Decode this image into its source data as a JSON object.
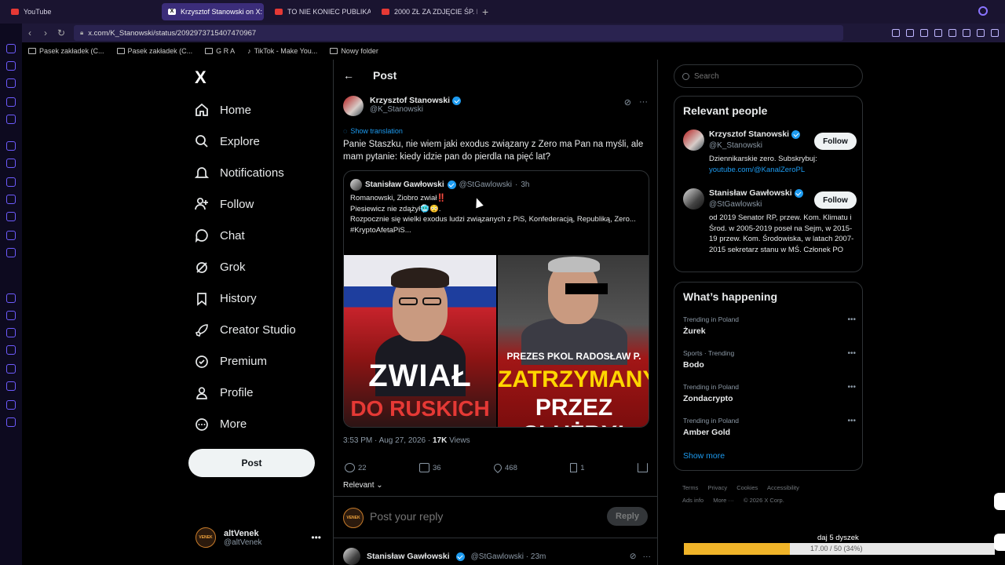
{
  "browser": {
    "tabs": [
      {
        "label": "YouTube",
        "icon": "youtube-icon",
        "active": false
      },
      {
        "label": "Krzysztof Stanowski on X:",
        "icon": "x-logo-icon",
        "active": true
      },
      {
        "label": "TO NIE KONIEC PUBLIKACJ",
        "icon": "youtube-icon",
        "active": false
      },
      {
        "label": "2000 ZŁ ZA ZDJĘCIE ŚP. L",
        "icon": "youtube-icon",
        "active": false
      }
    ],
    "url": "x.com/K_Stanowski/status/2092973715407470967",
    "bookmarks": [
      "Pasek zakładek (C...",
      "Pasek zakładek (C...",
      "G R A",
      "TikTok - Make You...",
      "Nowy folder"
    ]
  },
  "nav": {
    "logo": "X",
    "items": [
      {
        "label": "Home",
        "icon": "home-icon"
      },
      {
        "label": "Explore",
        "icon": "search-icon"
      },
      {
        "label": "Notifications",
        "icon": "bell-icon"
      },
      {
        "label": "Follow",
        "icon": "add-person-icon"
      },
      {
        "label": "Chat",
        "icon": "chat-bubble-icon"
      },
      {
        "label": "Grok",
        "icon": "grok-icon"
      },
      {
        "label": "History",
        "icon": "bookmark-icon"
      },
      {
        "label": "Creator Studio",
        "icon": "rocket-icon"
      },
      {
        "label": "Premium",
        "icon": "verified-icon"
      },
      {
        "label": "Profile",
        "icon": "person-icon"
      },
      {
        "label": "More",
        "icon": "more-circle-icon"
      }
    ],
    "post_label": "Post",
    "account": {
      "name": "altVenek",
      "handle": "@altVenek",
      "avatar_text": "VENEK"
    }
  },
  "post": {
    "header": "Post",
    "author": {
      "name": "Krzysztof Stanowski",
      "handle": "@K_Stanowski"
    },
    "translate_label": "Show translation",
    "text": "Panie Staszku, nie wiem jaki exodus związany z Zero ma Pan na myśli, ale mam pytanie: kiedy idzie pan do pierdla na pięć lat?",
    "quote": {
      "name": "Stanisław Gawłowski",
      "handle": "@StGawlowski",
      "time": "3h",
      "lines": [
        "Romanowski, Ziobro zwiał‼️",
        "Piesiewicz nie zdążył🥶😳.",
        "Rozpocznie się wielki exodus ludzi związanych z PiS, Konfederacją, Republiką, Zero...",
        "#KryptoAfetaPiS..."
      ],
      "image1": {
        "line1": "ZWIAŁ",
        "line2": "DO RUSKICH"
      },
      "image2": {
        "line1": "PREZES PKOL RADOSŁAW P.",
        "line2": "ZATRZYMANY",
        "line3": "PRZEZ SŁUŻBY!"
      }
    },
    "time": "3:53 PM · Aug 27, 2026 ·",
    "views_count": "17K",
    "views_label": "Views",
    "stats": {
      "replies": "22",
      "reposts": "36",
      "likes": "468",
      "bookmarks": "1"
    },
    "sort_label": "Relevant",
    "reply_placeholder": "Post your reply",
    "reply_button": "Reply",
    "next_reply": {
      "name": "Stanisław Gawłowski",
      "handle": "@StGawlowski · 23m"
    }
  },
  "right": {
    "search_placeholder": "Search",
    "relevant_title": "Relevant people",
    "people": [
      {
        "name": "Krzysztof Stanowski",
        "handle": "@K_Stanowski",
        "bio": "Dziennikarskie zero. Subskrybuj:",
        "link": "youtube.com/@KanalZeroPL",
        "follow": "Follow"
      },
      {
        "name": "Stanisław Gawłowski",
        "handle": "@StGawlowski",
        "bio": "od 2019 Senator RP, przew. Kom. Klimatu i Środ. w 2005-2019 poseł na Sejm, w 2015-19 przew. Kom. Środowiska, w latach 2007-2015 sekretarz stanu w MŚ. Członek PO",
        "link": "",
        "follow": "Follow"
      }
    ],
    "happening_title": "What’s happening",
    "trends": [
      {
        "context": "Trending in Poland",
        "topic": "Żurek"
      },
      {
        "context": "Sports · Trending",
        "topic": "Bodo"
      },
      {
        "context": "Trending in Poland",
        "topic": "Zondacrypto"
      },
      {
        "context": "Trending in Poland",
        "topic": "Amber Gold"
      }
    ],
    "show_more": "Show more",
    "footer": [
      "Terms",
      "Privacy",
      "Cookies",
      "Accessibility",
      "Ads info",
      "More ···",
      "© 2026 X Corp."
    ]
  },
  "overlay": {
    "label": "daj 5 dyszek",
    "progress_text": "17.00 / 50 (34%)",
    "progress_fraction": 0.34
  }
}
